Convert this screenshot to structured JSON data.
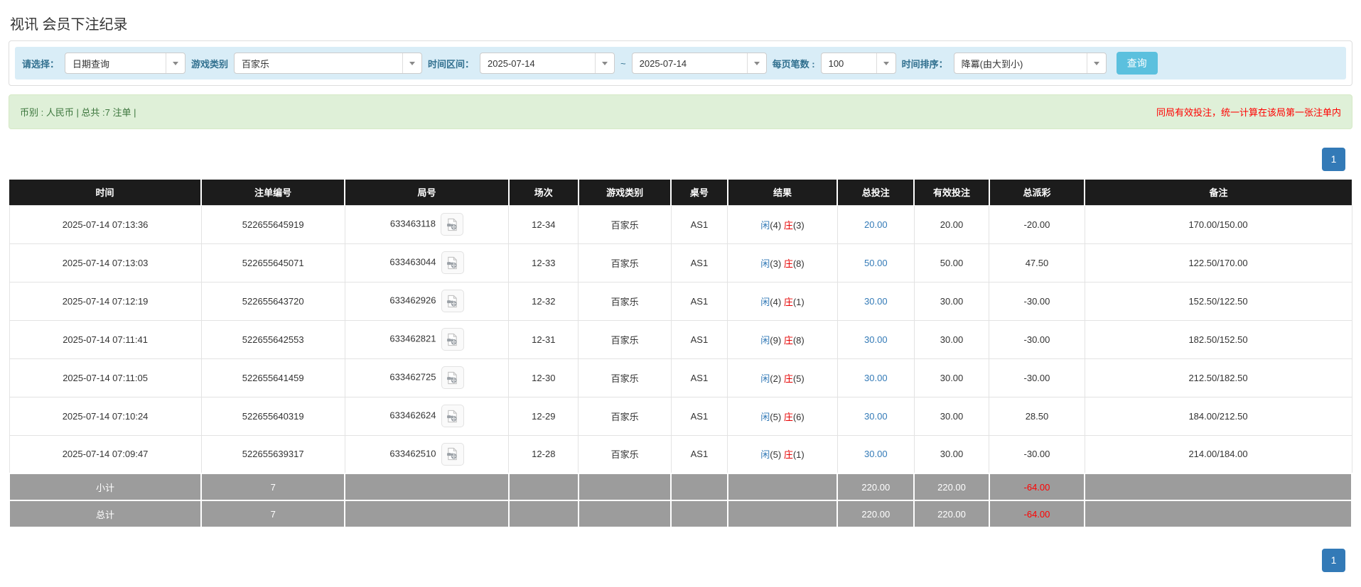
{
  "page": {
    "title": "视讯 会员下注纪录"
  },
  "filters": {
    "query_type_label": "请选择：",
    "query_type_value": "日期查询",
    "game_label": "游戏类别",
    "game_value": "百家乐",
    "range_label": "时间区间：",
    "date_from": "2025-07-14",
    "range_separator": "~",
    "date_to": "2025-07-14",
    "per_page_label": "每页笔数 :",
    "per_page_value": "100",
    "sort_label": "时间排序：",
    "sort_value": "降冪(由大到小)",
    "search_button": "查询"
  },
  "summary": {
    "left": "币别 : 人民币 | 总共 :7 注单 |",
    "right": "同局有效投注，统一计算在该局第一张注单内"
  },
  "pagination": {
    "page": "1"
  },
  "table": {
    "headers": [
      "时间",
      "注单编号",
      "局号",
      "场次",
      "游戏类别",
      "桌号",
      "结果",
      "总投注",
      "有效投注",
      "总派彩",
      "备注"
    ],
    "rows": [
      {
        "time": "2025-07-14 07:13:36",
        "bet_id": "522655645919",
        "round_id": "633463118",
        "session": "12-34",
        "game": "百家乐",
        "table_no": "AS1",
        "result": {
          "player": "闲",
          "player_n": "(4)",
          "banker": "庄",
          "banker_n": "(3)"
        },
        "total_bet": "20.00",
        "valid_bet": "20.00",
        "payout": "-20.00",
        "payout_negative": true,
        "remark": "170.00/150.00"
      },
      {
        "time": "2025-07-14 07:13:03",
        "bet_id": "522655645071",
        "round_id": "633463044",
        "session": "12-33",
        "game": "百家乐",
        "table_no": "AS1",
        "result": {
          "player": "闲",
          "player_n": "(3)",
          "banker": "庄",
          "banker_n": "(8)"
        },
        "total_bet": "50.00",
        "valid_bet": "50.00",
        "payout": "47.50",
        "payout_negative": false,
        "remark": "122.50/170.00"
      },
      {
        "time": "2025-07-14 07:12:19",
        "bet_id": "522655643720",
        "round_id": "633462926",
        "session": "12-32",
        "game": "百家乐",
        "table_no": "AS1",
        "result": {
          "player": "闲",
          "player_n": "(4)",
          "banker": "庄",
          "banker_n": "(1)"
        },
        "total_bet": "30.00",
        "valid_bet": "30.00",
        "payout": "-30.00",
        "payout_negative": true,
        "remark": "152.50/122.50"
      },
      {
        "time": "2025-07-14 07:11:41",
        "bet_id": "522655642553",
        "round_id": "633462821",
        "session": "12-31",
        "game": "百家乐",
        "table_no": "AS1",
        "result": {
          "player": "闲",
          "player_n": "(9)",
          "banker": "庄",
          "banker_n": "(8)"
        },
        "total_bet": "30.00",
        "valid_bet": "30.00",
        "payout": "-30.00",
        "payout_negative": true,
        "remark": "182.50/152.50"
      },
      {
        "time": "2025-07-14 07:11:05",
        "bet_id": "522655641459",
        "round_id": "633462725",
        "session": "12-30",
        "game": "百家乐",
        "table_no": "AS1",
        "result": {
          "player": "闲",
          "player_n": "(2)",
          "banker": "庄",
          "banker_n": "(5)"
        },
        "total_bet": "30.00",
        "valid_bet": "30.00",
        "payout": "-30.00",
        "payout_negative": true,
        "remark": "212.50/182.50"
      },
      {
        "time": "2025-07-14 07:10:24",
        "bet_id": "522655640319",
        "round_id": "633462624",
        "session": "12-29",
        "game": "百家乐",
        "table_no": "AS1",
        "result": {
          "player": "闲",
          "player_n": "(5)",
          "banker": "庄",
          "banker_n": "(6)"
        },
        "total_bet": "30.00",
        "valid_bet": "30.00",
        "payout": "28.50",
        "payout_negative": false,
        "remark": "184.00/212.50"
      },
      {
        "time": "2025-07-14 07:09:47",
        "bet_id": "522655639317",
        "round_id": "633462510",
        "session": "12-28",
        "game": "百家乐",
        "table_no": "AS1",
        "result": {
          "player": "闲",
          "player_n": "(5)",
          "banker": "庄",
          "banker_n": "(1)"
        },
        "total_bet": "30.00",
        "valid_bet": "30.00",
        "payout": "-30.00",
        "payout_negative": true,
        "remark": "214.00/184.00"
      }
    ],
    "subtotal": {
      "label": "小计",
      "count": "7",
      "total_bet": "220.00",
      "valid_bet": "220.00",
      "payout": "-64.00"
    },
    "total": {
      "label": "总计",
      "count": "7",
      "total_bet": "220.00",
      "valid_bet": "220.00",
      "payout": "-64.00"
    }
  },
  "colors": {
    "accent_blue": "#337ab7",
    "banker_red": "#e60000",
    "negative_red": "#ff0000",
    "header_bg": "#1c1c1c",
    "footer_bg": "#9c9c9c",
    "filter_bg": "#d9edf7",
    "filter_label": "#31708f",
    "summary_bg": "#dff0d8",
    "summary_border": "#d6e9c6",
    "summary_text": "#3c763d",
    "search_btn": "#5bc0de"
  }
}
